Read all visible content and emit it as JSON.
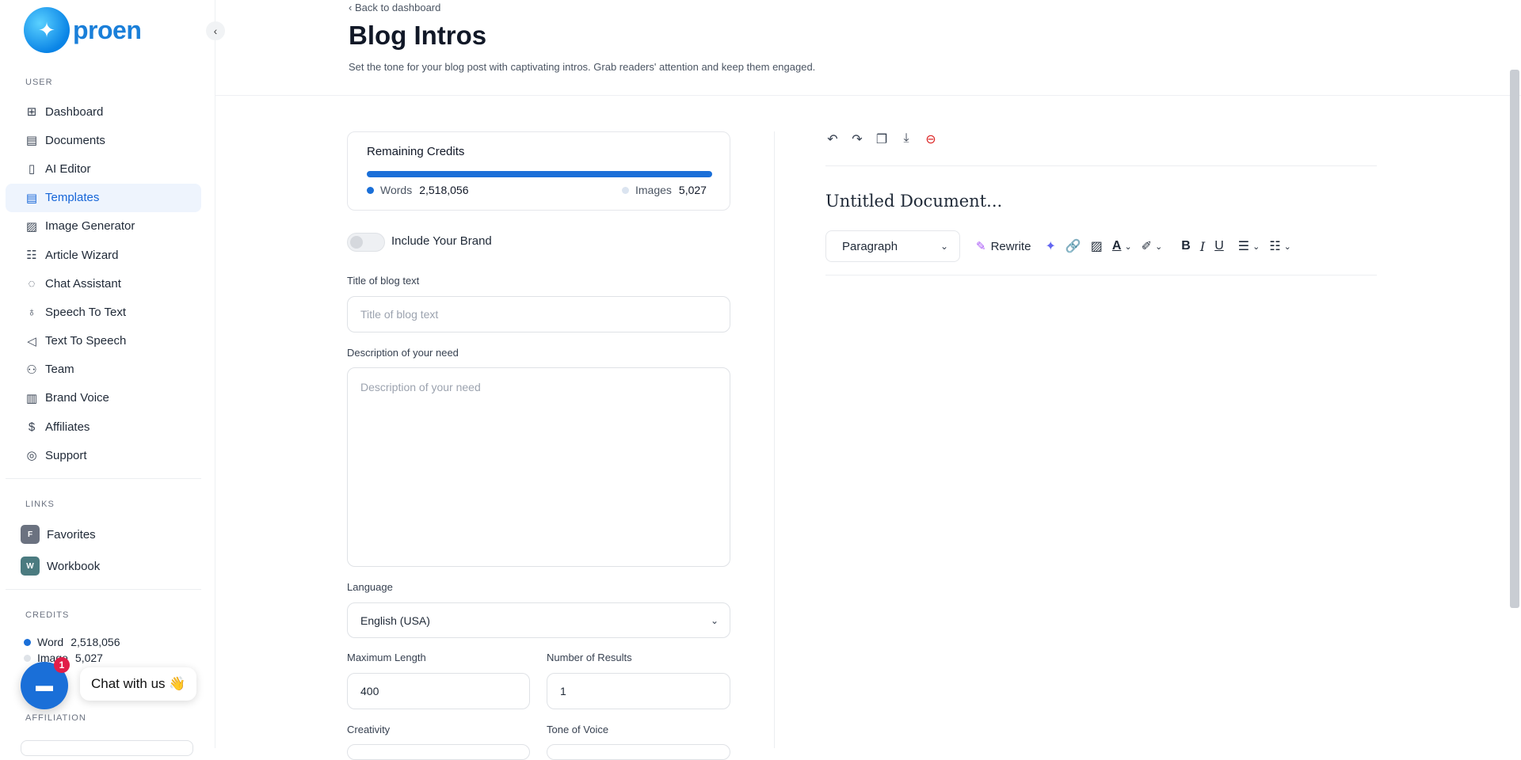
{
  "brand": {
    "name": "proen"
  },
  "sidebar": {
    "user_label": "USER",
    "items": [
      {
        "label": "Dashboard",
        "icon": "grid-icon",
        "glyph": "⊞"
      },
      {
        "label": "Documents",
        "icon": "archive-icon",
        "glyph": "▤"
      },
      {
        "label": "AI Editor",
        "icon": "notebook-icon",
        "glyph": "▯"
      },
      {
        "label": "Templates",
        "icon": "file-text-icon",
        "glyph": "▤"
      },
      {
        "label": "Image Generator",
        "icon": "image-icon",
        "glyph": "▨"
      },
      {
        "label": "Article Wizard",
        "icon": "file-list-icon",
        "glyph": "☷"
      },
      {
        "label": "Chat Assistant",
        "icon": "chat-icon",
        "glyph": "◌"
      },
      {
        "label": "Speech To Text",
        "icon": "microphone-icon",
        "glyph": "♁"
      },
      {
        "label": "Text To Speech",
        "icon": "speaker-icon",
        "glyph": "◁"
      },
      {
        "label": "Team",
        "icon": "user-plus-icon",
        "glyph": "⚇"
      },
      {
        "label": "Brand Voice",
        "icon": "brand-icon",
        "glyph": "▥"
      },
      {
        "label": "Affiliates",
        "icon": "dollar-icon",
        "glyph": "$"
      },
      {
        "label": "Support",
        "icon": "lifebuoy-icon",
        "glyph": "◎"
      }
    ],
    "links_label": "LINKS",
    "links": [
      {
        "label": "Favorites",
        "badge": "F",
        "color": "#6b7280"
      },
      {
        "label": "Workbook",
        "badge": "W",
        "color": "#4b7b80"
      }
    ],
    "credits_label": "CREDITS",
    "credits": {
      "word_label": "Word",
      "word_value": "2,518,056",
      "image_label": "Image",
      "image_value": "5,027"
    },
    "affiliation_label": "AFFILIATION"
  },
  "chat": {
    "label": "Chat with us 👋",
    "badge": "1"
  },
  "header": {
    "back": "Back to dashboard",
    "title": "Blog Intros",
    "subtitle": "Set the tone for your blog post with captivating intros. Grab readers' attention and keep them engaged."
  },
  "form": {
    "credits_title": "Remaining Credits",
    "words_label": "Words",
    "words_value": "2,518,056",
    "images_label": "Images",
    "images_value": "5,027",
    "words_fraction": 1.0,
    "brand_toggle_label": "Include Your Brand",
    "title_label": "Title of blog text",
    "title_placeholder": "Title of blog text",
    "desc_label": "Description of your need",
    "desc_placeholder": "Description of your need",
    "language_label": "Language",
    "language_value": "English (USA)",
    "maxlen_label": "Maximum Length",
    "maxlen_value": "400",
    "results_label": "Number of Results",
    "results_value": "1",
    "creativity_label": "Creativity",
    "tone_label": "Tone of Voice"
  },
  "editor": {
    "doc_title": "Untitled Document...",
    "paragraph": "Paragraph",
    "rewrite": "Rewrite"
  },
  "colors": {
    "accent": "#1a6fd8",
    "active_bg": "#eef4fd"
  }
}
